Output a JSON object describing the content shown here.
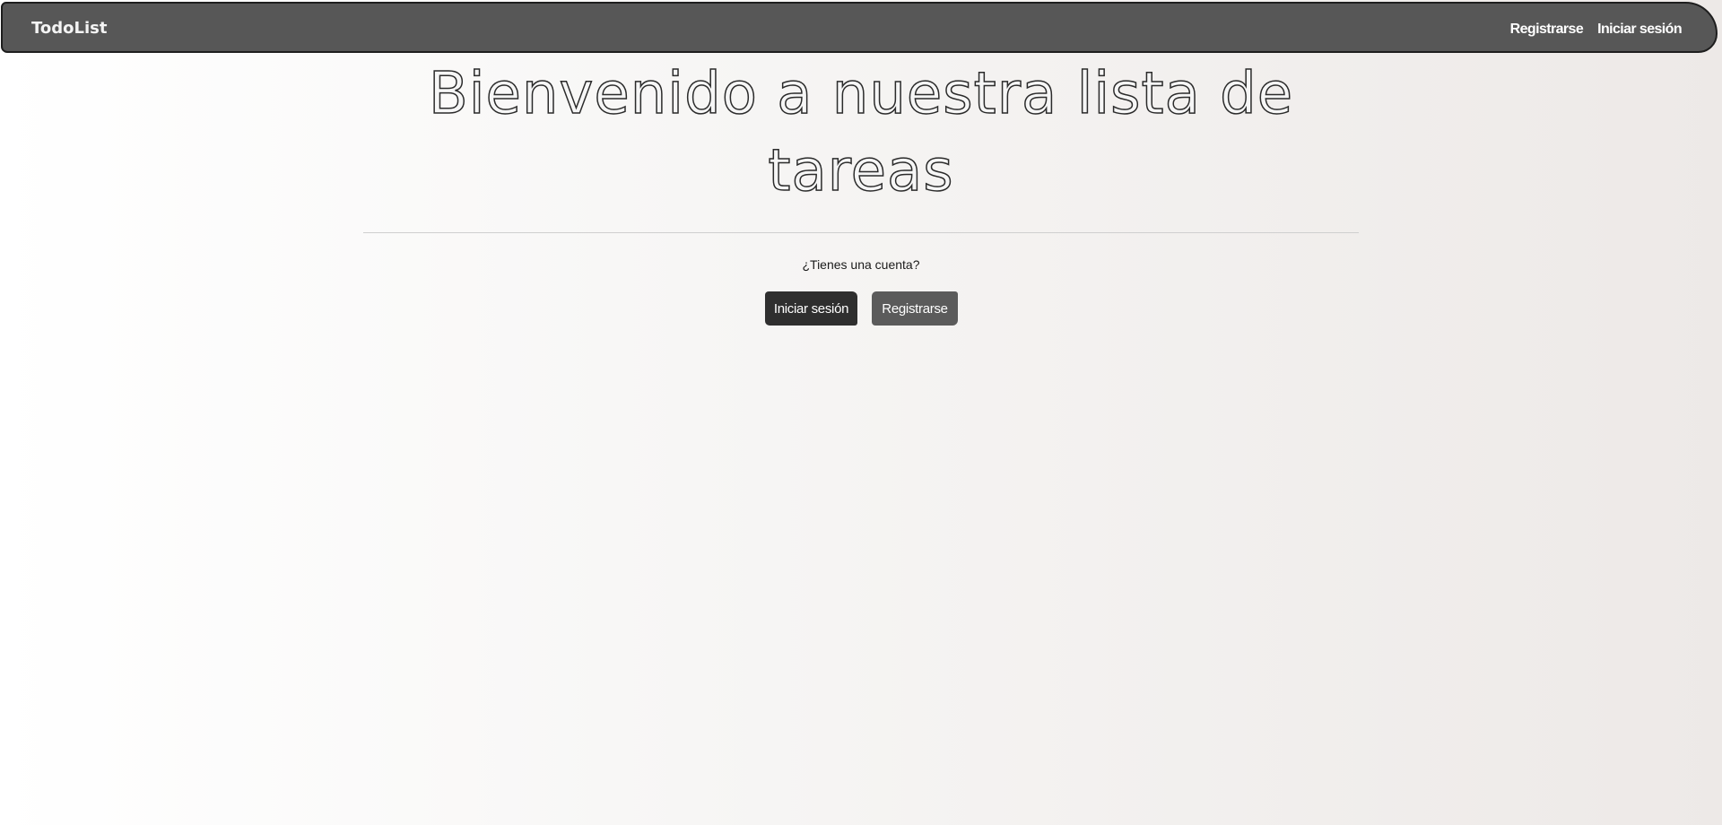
{
  "navbar": {
    "brand": "TodoList",
    "links": [
      {
        "label": "Registrarse"
      },
      {
        "label": "Iniciar sesión"
      }
    ]
  },
  "hero": {
    "title": "Bienvenido a nuestra lista de tareas"
  },
  "auth_prompt": {
    "question": "¿Tienes una cuenta?",
    "login_label": "Iniciar sesión",
    "register_label": "Registrarse"
  },
  "colors": {
    "navbar_bg": "#575757",
    "primary_button": "#2f2f2f",
    "secondary_button": "#5b5b5b"
  }
}
